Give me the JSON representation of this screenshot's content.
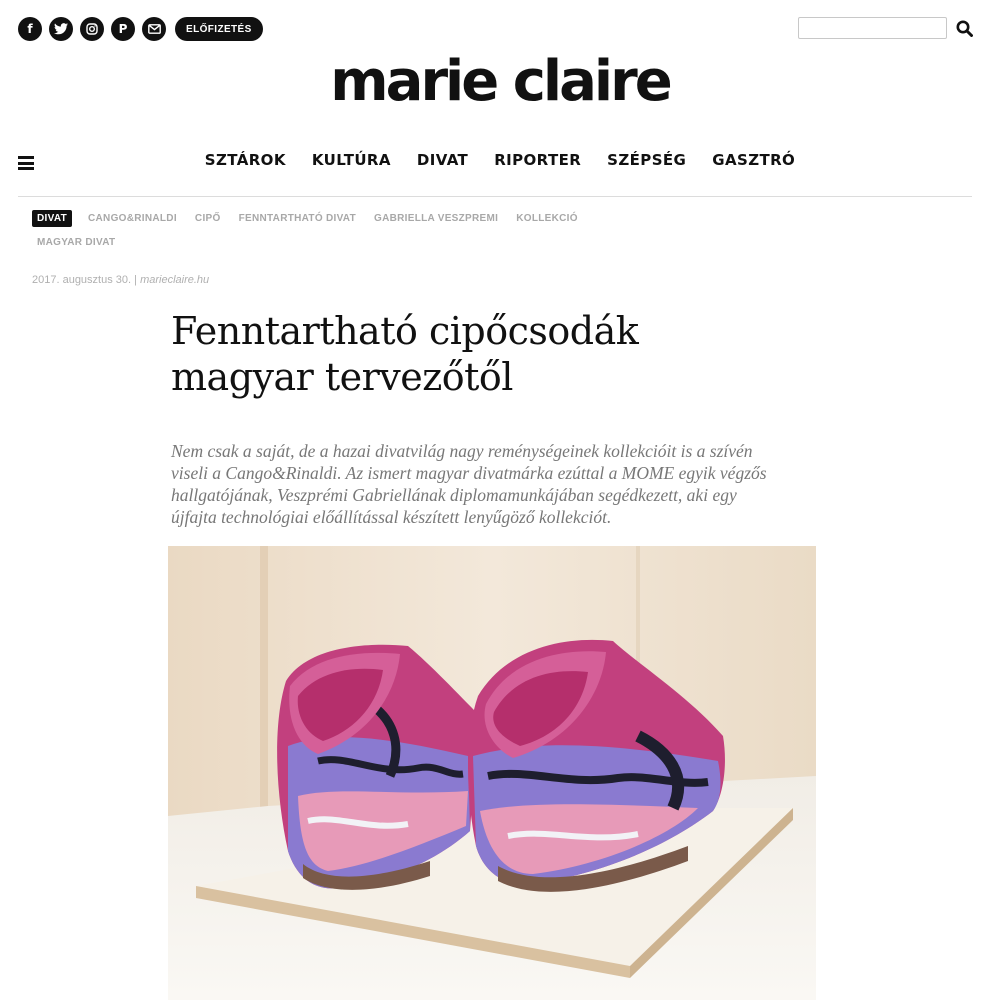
{
  "topbar": {
    "social": [
      {
        "name": "facebook-icon",
        "glyph": "f"
      },
      {
        "name": "twitter-icon"
      },
      {
        "name": "instagram-icon"
      },
      {
        "name": "pinterest-icon",
        "glyph": "P"
      },
      {
        "name": "email-icon"
      }
    ],
    "subscribe_label": "ELŐFIZETÉS",
    "search": {
      "value": "",
      "placeholder": "",
      "icon": "search-icon"
    }
  },
  "logo": "marie claire",
  "nav": {
    "menu_icon": "hamburger-icon",
    "items": [
      "SZTÁROK",
      "KULTÚRA",
      "DIVAT",
      "RIPORTER",
      "SZÉPSÉG",
      "GASZTRÓ"
    ]
  },
  "tags": [
    "DIVAT",
    "CANGO&RINALDI",
    "CIPŐ",
    "FENNTARTHATÓ DIVAT",
    "GABRIELLA VESZPREMI",
    "KOLLEKCIÓ",
    "MAGYAR DIVAT"
  ],
  "article": {
    "date": "2017. augusztus 30.",
    "separator": "|",
    "source": "marieclaire.hu",
    "title_lines": [
      "Fenntartható cipőcsodák",
      "magyar tervezőtől"
    ],
    "lead_lines": [
      "Nem csak a saját, de a hazai divatvilág nagy reménységeinek kollekcióit is a szívén",
      "viseli a Cango&Rinaldi. Az ismert magyar divatmárka ezúttal a MOME egyik végzős",
      "hallgatójának, Veszprémi Gabriellának diplomamunkájában segédkezett, aki egy",
      "újfajta technológiai előállítással készített lenyűgöző kollekciót."
    ]
  },
  "colors": {
    "accent": "#111111",
    "tag_inactive": "#a8a8a8",
    "lead_text": "#777777",
    "shoe_pink": "#c2407e"
  }
}
